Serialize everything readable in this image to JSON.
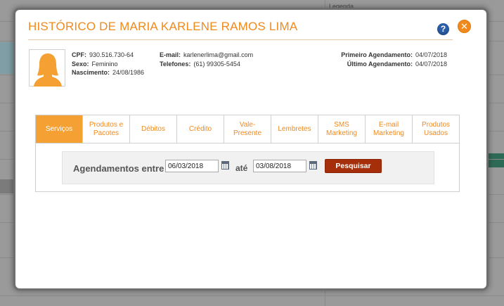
{
  "background": {
    "label": "Legenda"
  },
  "modal": {
    "title": "HISTÓRICO DE MARIA KARLENE RAMOS LIMA",
    "help_icon": "?",
    "close_icon": "✕"
  },
  "client": {
    "cpf_label": "CPF:",
    "cpf": "930.516.730-64",
    "sexo_label": "Sexo:",
    "sexo": "Feminino",
    "nascimento_label": "Nascimento:",
    "nascimento": "24/08/1986",
    "email_label": "E-mail:",
    "email": "karlenerlima@gmail.com",
    "telefones_label": "Telefones:",
    "telefones": "(61) 99305-5454",
    "primeiro_label": "Primeiro Agendamento:",
    "primeiro": "04/07/2018",
    "ultimo_label": "Último Agendamento:",
    "ultimo": "04/07/2018"
  },
  "tabs": [
    {
      "label": "Serviços"
    },
    {
      "label": "Produtos e Pacotes"
    },
    {
      "label": "Débitos"
    },
    {
      "label": "Crédito"
    },
    {
      "label": "Vale-Presente"
    },
    {
      "label": "Lembretes"
    },
    {
      "label": "SMS Marketing"
    },
    {
      "label": "E-mail Marketing"
    },
    {
      "label": "Produtos Usados"
    }
  ],
  "filter": {
    "label": "Agendamentos entre",
    "start_date": "06/03/2018",
    "ate_label": "até",
    "end_date": "03/08/2018",
    "search_label": "Pesquisar"
  },
  "colors": {
    "accent": "#f08a1d",
    "active_tab": "#f5a033",
    "search_button": "#a52f0a",
    "help_icon": "#2a5ea8"
  }
}
